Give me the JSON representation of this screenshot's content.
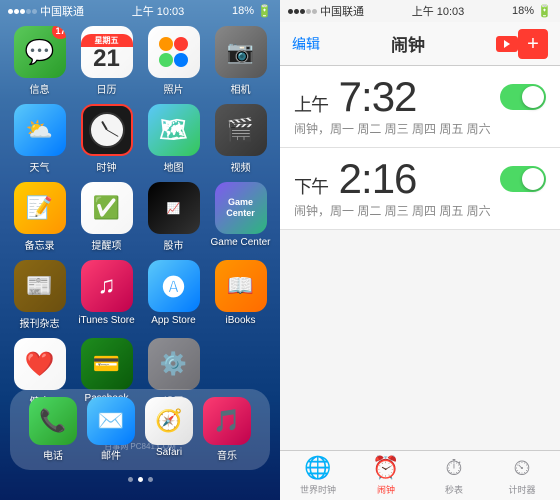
{
  "left": {
    "statusBar": {
      "carrier": "中国联通",
      "time": "上午 10:03",
      "battery": "18%",
      "signal": 3
    },
    "apps": [
      {
        "id": "messages",
        "label": "信息",
        "icon": "messages",
        "badge": null
      },
      {
        "id": "calendar",
        "label": "日历",
        "icon": "calendar",
        "badge": null
      },
      {
        "id": "photos",
        "label": "照片",
        "icon": "photos",
        "badge": null
      },
      {
        "id": "camera",
        "label": "相机",
        "icon": "camera",
        "badge": null
      },
      {
        "id": "weather",
        "label": "天气",
        "icon": "weather",
        "badge": null
      },
      {
        "id": "clock",
        "label": "时钟",
        "icon": "clock",
        "badge": null,
        "highlighted": true
      },
      {
        "id": "maps",
        "label": "地图",
        "icon": "maps",
        "badge": null
      },
      {
        "id": "videos",
        "label": "视频",
        "icon": "videos",
        "badge": null
      },
      {
        "id": "notes",
        "label": "备忘录",
        "icon": "notes",
        "badge": null
      },
      {
        "id": "reminders",
        "label": "提醒项",
        "icon": "reminders",
        "badge": null
      },
      {
        "id": "stocks",
        "label": "股市",
        "icon": "stocks",
        "badge": null
      },
      {
        "id": "gamecenter",
        "label": "Game Center",
        "icon": "gamecenter",
        "badge": null
      },
      {
        "id": "newsstand",
        "label": "报刊杂志",
        "icon": "newsstand",
        "badge": null
      },
      {
        "id": "itunes",
        "label": "iTunes Store",
        "icon": "itunes",
        "badge": null
      },
      {
        "id": "appstore",
        "label": "App Store",
        "icon": "appstore",
        "badge": null
      },
      {
        "id": "ibooks",
        "label": "iBooks",
        "icon": "ibooks",
        "badge": null
      },
      {
        "id": "health",
        "label": "健康",
        "icon": "health",
        "badge": null
      },
      {
        "id": "passbook",
        "label": "Passbook",
        "icon": "passbook",
        "badge": null
      },
      {
        "id": "settings",
        "label": "设置",
        "icon": "settings",
        "badge": null
      }
    ],
    "dock": [
      {
        "id": "phone",
        "label": "电话",
        "icon": "phone"
      },
      {
        "id": "mail",
        "label": "邮件",
        "icon": "mail"
      },
      {
        "id": "safari",
        "label": "Safari",
        "icon": "safari"
      },
      {
        "id": "music",
        "label": "音乐",
        "icon": "music"
      }
    ],
    "watermark": "百事网\nPC841.COM",
    "messageBadge": "17"
  },
  "right": {
    "statusBar": {
      "carrier": "中国联通",
      "time": "上午 10:03",
      "battery": "18%"
    },
    "navBar": {
      "editLabel": "编辑",
      "title": "闹钟",
      "addLabel": "+"
    },
    "alarms": [
      {
        "period": "上午",
        "time": "7:32",
        "enabled": true,
        "label": "闹钟，周一 周二 周三 周四 周五 周六"
      },
      {
        "period": "下午",
        "time": "2:16",
        "enabled": true,
        "label": "闹钟，周一 周二 周三 周四 周五 周六"
      }
    ],
    "tabs": [
      {
        "id": "world",
        "label": "世界时钟",
        "icon": "🌐",
        "active": false
      },
      {
        "id": "alarm",
        "label": "闹钟",
        "icon": "⏰",
        "active": true
      },
      {
        "id": "stopwatch",
        "label": "秒表",
        "icon": "⏱",
        "active": false
      },
      {
        "id": "timer",
        "label": "计时器",
        "icon": "⏲",
        "active": false
      }
    ]
  }
}
